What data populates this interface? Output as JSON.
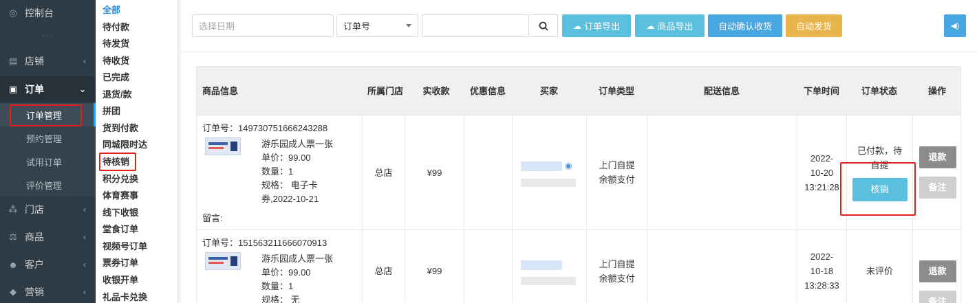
{
  "sidebar": {
    "items": [
      {
        "label": "控制台",
        "icon": "dashboard-icon"
      },
      {
        "label": "店铺",
        "icon": "shop-icon"
      },
      {
        "label": "订单",
        "icon": "order-icon"
      },
      {
        "label": "门店",
        "icon": "store-icon"
      },
      {
        "label": "商品",
        "icon": "goods-icon"
      },
      {
        "label": "客户",
        "icon": "customers-icon"
      },
      {
        "label": "营销",
        "icon": "marketing-icon"
      }
    ],
    "dots": "...",
    "order_sub": [
      "订单管理",
      "预约管理",
      "试用订单",
      "评价管理"
    ]
  },
  "subnav": [
    "全部",
    "待付款",
    "待发货",
    "待收货",
    "已完成",
    "退货/款",
    "拼团",
    "货到付款",
    "同城限时达",
    "待核销",
    "积分兑换",
    "体育赛事",
    "线下收银",
    "堂食订单",
    "视频号订单",
    "票券订单",
    "收银开单",
    "礼品卡兑换"
  ],
  "toolbar": {
    "date_placeholder": "选择日期",
    "select_value": "订单号",
    "keyword_placeholder": "",
    "export_orders": "订单导出",
    "export_goods": "商品导出",
    "auto_confirm": "自动确认收货",
    "auto_ship": "自动发货"
  },
  "colors": {
    "sidebar": "#2f3b44",
    "info": "#5bc0de",
    "primary": "#2fa4e7",
    "warning": "#e8b44c",
    "danger": "#e0201b"
  },
  "table": {
    "headers": {
      "goods": "商品信息",
      "store": "所属门店",
      "paid": "实收款",
      "discount": "优惠信息",
      "buyer": "买家",
      "type": "订单类型",
      "delivery": "配送信息",
      "time": "下单时间",
      "status": "订单状态",
      "op": "操作"
    },
    "rows": [
      {
        "order_no": "订单号：149730751666243288",
        "product": "游乐园成人票一张",
        "price": "单价：99.00",
        "qty": "数量：1",
        "spec_1": "规格： 电子卡",
        "spec_2": "券,2022-10-21",
        "memo": "留言:",
        "store": "总店",
        "paid": "¥99",
        "type_1": "上门自提",
        "type_2": "余额支付",
        "time_1": "2022-",
        "time_2": "10-20",
        "time_3": "13:21:28",
        "status_1": "已付款，待",
        "status_2": "自提",
        "verify": "核销",
        "refund": "退款",
        "note": "备注"
      },
      {
        "order_no": "订单号：151563211666070913",
        "product": "游乐园成人票一张",
        "price": "单价：99.00",
        "qty": "数量：1",
        "spec_1": "规格： 无",
        "store": "总店",
        "paid": "¥99",
        "type_1": "上门自提",
        "type_2": "余额支付",
        "time_1": "2022-",
        "time_2": "10-18",
        "time_3": "13:28:33",
        "status_1": "未评价",
        "refund": "退款",
        "note": "备注"
      }
    ]
  }
}
